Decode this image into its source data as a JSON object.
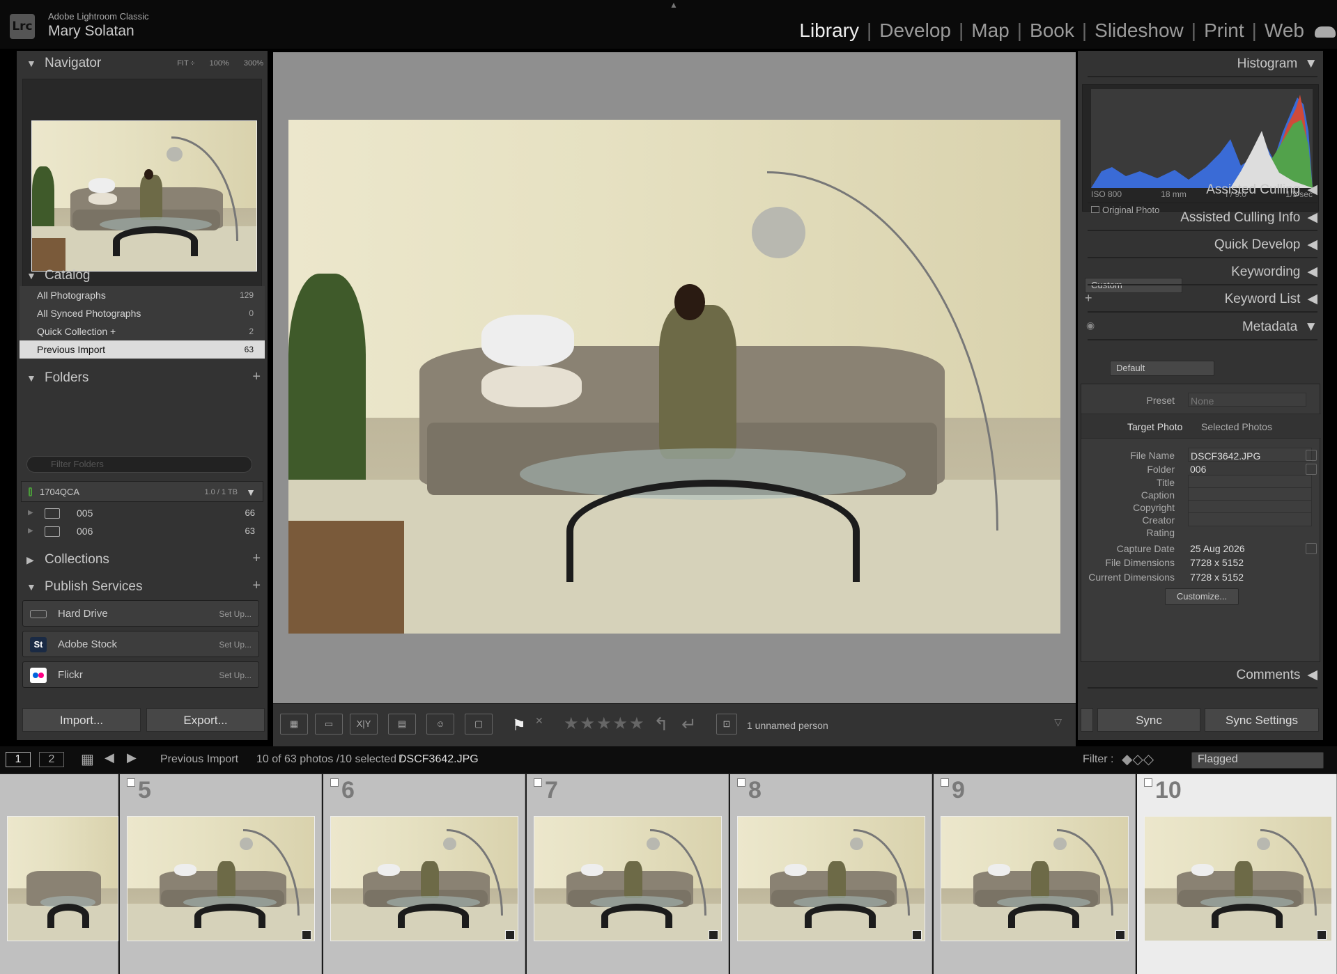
{
  "app": {
    "name": "Adobe Lightroom Classic",
    "logo": "Lrc",
    "user": "Mary Solatan"
  },
  "modules": [
    "Library",
    "Develop",
    "Map",
    "Book",
    "Slideshow",
    "Print",
    "Web"
  ],
  "navigator": {
    "title": "Navigator",
    "fit": "FIT ÷",
    "z100": "100%",
    "z300": "300%"
  },
  "catalog": {
    "title": "Catalog",
    "items": [
      {
        "label": "All Photographs",
        "count": "129"
      },
      {
        "label": "All Synced Photographs",
        "count": "0"
      },
      {
        "label": "Quick Collection +",
        "count": "2"
      },
      {
        "label": "Previous Import",
        "count": "63"
      }
    ]
  },
  "folders": {
    "title": "Folders",
    "filter_placeholder": "Filter Folders",
    "drive": {
      "name": "1704QCA",
      "size": "1.0 / 1 TB"
    },
    "items": [
      {
        "name": "005",
        "count": "66"
      },
      {
        "name": "006",
        "count": "63"
      }
    ]
  },
  "collections": {
    "title": "Collections"
  },
  "publish": {
    "title": "Publish Services",
    "items": [
      {
        "label": "Hard Drive",
        "setup": "Set Up..."
      },
      {
        "label": "Adobe Stock",
        "setup": "Set Up...",
        "icon": "St"
      },
      {
        "label": "Flickr",
        "setup": "Set Up..."
      }
    ]
  },
  "left_buttons": {
    "import": "Import...",
    "export": "Export..."
  },
  "toolbar": {
    "people": "1 unnamed person",
    "stars": "★★★★★",
    "compare": "X|Y"
  },
  "right": {
    "histogram": "Histogram",
    "iso": "ISO 800",
    "focal": "18 mm",
    "aperture": "f / 9.0",
    "shutter": "1/5 sec",
    "original": "Original Photo",
    "assisted_culling": "Assisted Culling",
    "assisted_culling_info": "Assisted Culling Info",
    "quick_develop": "Quick Develop",
    "qd_preset": "Custom",
    "keywording": "Keywording",
    "keyword_list": "Keyword List",
    "metadata": "Metadata",
    "meta_preset": "Default",
    "preset_label": "Preset",
    "preset_value": "None",
    "tab_target": "Target Photo",
    "tab_selected": "Selected Photos",
    "fields": [
      {
        "label": "File Name",
        "value": "DSCF3642.JPG"
      },
      {
        "label": "Folder",
        "value": "006"
      },
      {
        "label": "Title",
        "value": ""
      },
      {
        "label": "Caption",
        "value": ""
      },
      {
        "label": "Copyright",
        "value": ""
      },
      {
        "label": "Creator",
        "value": ""
      },
      {
        "label": "Rating",
        "value": ""
      },
      {
        "label": "Capture Date",
        "value": "25 Aug 2026"
      },
      {
        "label": "File Dimensions",
        "value": "7728 x 5152"
      },
      {
        "label": "Current Dimensions",
        "value": "7728 x 5152"
      }
    ],
    "customize": "Customize...",
    "comments": "Comments",
    "sync": "Sync",
    "sync_settings": "Sync Settings"
  },
  "filmstrip_bar": {
    "view1": "1",
    "view2": "2",
    "source": "Previous Import",
    "count": "10 of 63 photos /10 selected /",
    "file": "DSCF3642.JPG",
    "filter_label": "Filter :",
    "filter_value": "Flagged"
  },
  "filmstrip": [
    "5",
    "6",
    "7",
    "8",
    "9",
    "10"
  ]
}
